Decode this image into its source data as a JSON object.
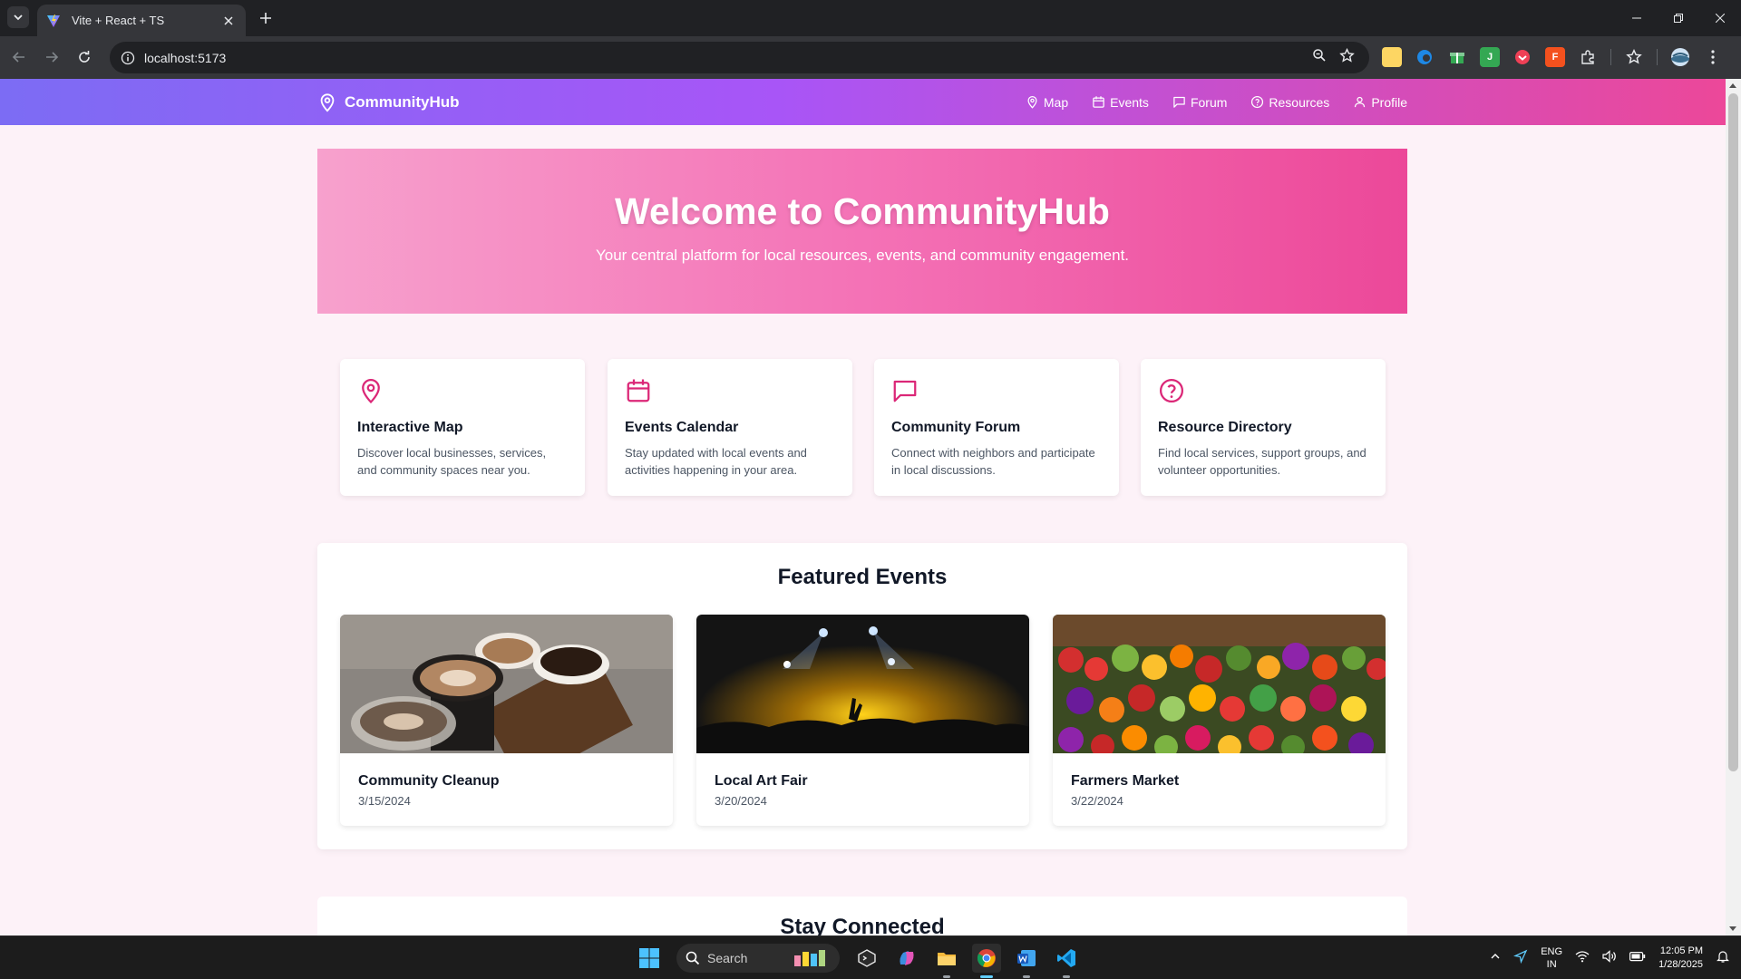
{
  "browser": {
    "tab_title": "Vite + React + TS",
    "url": "localhost:5173"
  },
  "app": {
    "brand": "CommunityHub",
    "nav": [
      {
        "label": "Map",
        "icon": "map-pin-icon"
      },
      {
        "label": "Events",
        "icon": "calendar-icon"
      },
      {
        "label": "Forum",
        "icon": "message-square-icon"
      },
      {
        "label": "Resources",
        "icon": "help-circle-icon"
      },
      {
        "label": "Profile",
        "icon": "user-icon"
      }
    ]
  },
  "hero": {
    "title": "Welcome to CommunityHub",
    "subtitle": "Your central platform for local resources, events, and community engagement."
  },
  "features": [
    {
      "title": "Interactive Map",
      "description": "Discover local businesses, services, and community spaces near you.",
      "icon": "map-pin-icon"
    },
    {
      "title": "Events Calendar",
      "description": "Stay updated with local events and activities happening in your area.",
      "icon": "calendar-icon"
    },
    {
      "title": "Community Forum",
      "description": "Connect with neighbors and participate in local discussions.",
      "icon": "message-square-icon"
    },
    {
      "title": "Resource Directory",
      "description": "Find local services, support groups, and volunteer opportunities.",
      "icon": "help-circle-icon"
    }
  ],
  "featured_events": {
    "heading": "Featured Events",
    "items": [
      {
        "name": "Community Cleanup",
        "date": "3/15/2024",
        "image": "coffee-cups-image"
      },
      {
        "name": "Local Art Fair",
        "date": "3/20/2024",
        "image": "concert-crowd-image"
      },
      {
        "name": "Farmers Market",
        "date": "3/22/2024",
        "image": "vegetable-market-image"
      }
    ]
  },
  "connect": {
    "heading": "Stay Connected"
  },
  "taskbar": {
    "search_label": "Search",
    "lang_line1": "ENG",
    "lang_line2": "IN",
    "time": "12:05 PM",
    "date": "1/28/2025"
  },
  "colors": {
    "accent": "#db2777",
    "nav_gradient_start": "#7c6cf4",
    "nav_gradient_end": "#ec4899",
    "hero_gradient_start": "#f7a1cd",
    "hero_gradient_end": "#ec4899",
    "page_bg": "#fdf2f8"
  }
}
